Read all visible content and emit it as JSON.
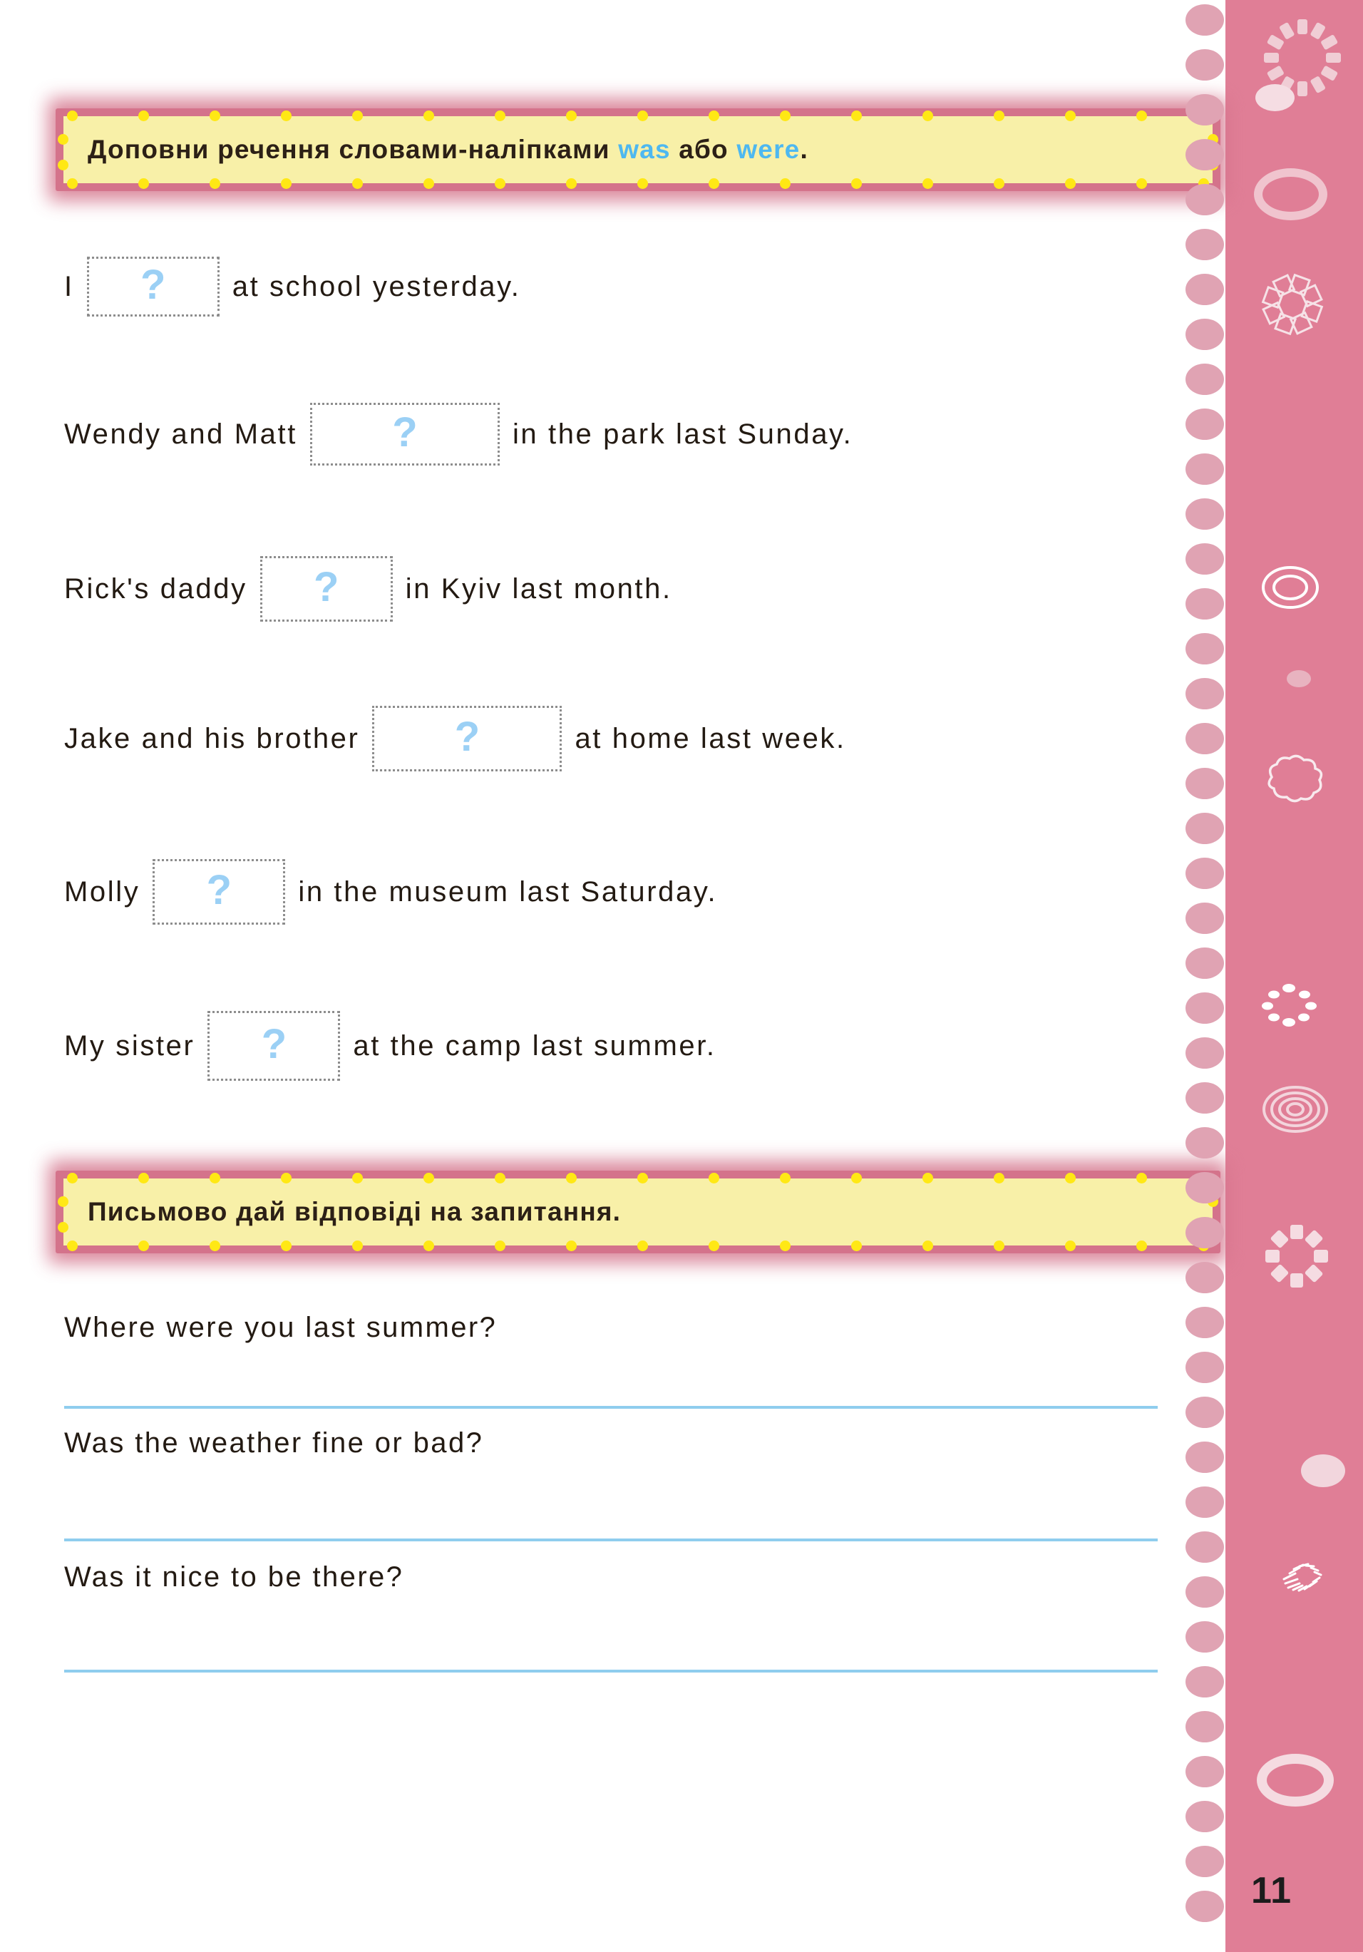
{
  "page": {
    "number": "11",
    "accent_pink": "#e07e96",
    "banner_frame": "#d4738b",
    "banner_fill": "#f8f0a8",
    "banner_dot": "#ffe815",
    "highlight_blue": "#4eb8f0",
    "question_mark_blue": "#9bd0f5",
    "answer_line_blue": "#8fcdee",
    "text_color": "#231a12"
  },
  "task1": {
    "banner": {
      "prefix": "Доповни  речення  словами-наліпками  ",
      "word_was": "was",
      "middle": "  або  ",
      "word_were": "were",
      "suffix": "."
    },
    "sentences": [
      {
        "before": "I",
        "blank_placeholder": "?",
        "after": "at  school  yesterday.",
        "blank_width": 186,
        "blank_height": 84
      },
      {
        "before": "Wendy  and  Matt",
        "blank_placeholder": "?",
        "after": "in  the  park  last  Sunday.",
        "blank_width": 266,
        "blank_height": 88
      },
      {
        "before": "Rick's  daddy",
        "blank_placeholder": "?",
        "after": "in  Kyiv  last  month.",
        "blank_width": 186,
        "blank_height": 92
      },
      {
        "before": "Jake  and  his  brother",
        "blank_placeholder": "?",
        "after": "at  home  last  week.",
        "blank_width": 266,
        "blank_height": 92
      },
      {
        "before": "Molly",
        "blank_placeholder": "?",
        "after": "in  the  museum  last  Saturday.",
        "blank_width": 186,
        "blank_height": 92
      },
      {
        "before": "My  sister",
        "blank_placeholder": "?",
        "after": "at  the  camp  last  summer.",
        "blank_width": 186,
        "blank_height": 98
      }
    ]
  },
  "task2": {
    "banner": {
      "text": "Письмово  дай  відповіді  на  запитання."
    },
    "questions": [
      {
        "text": "Where  were  you  last  summer?"
      },
      {
        "text": "Was  the  weather  fine  or  bad?"
      },
      {
        "text": "Was  it  nice  to  be  there?"
      }
    ]
  }
}
